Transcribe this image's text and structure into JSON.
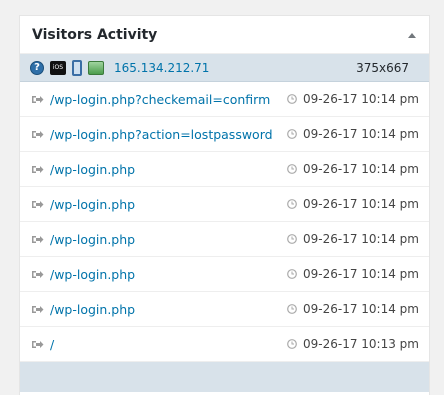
{
  "widget": {
    "title": "Visitors Activity"
  },
  "visitor": {
    "ip": "165.134.212.71",
    "resolution": "375x667",
    "os_label": "iOS"
  },
  "activity": [
    {
      "page": "/wp-login.php?checkemail=confirm",
      "time": "09-26-17 10:14 pm"
    },
    {
      "page": "/wp-login.php?action=lostpassword",
      "time": "09-26-17 10:14 pm"
    },
    {
      "page": "/wp-login.php",
      "time": "09-26-17 10:14 pm"
    },
    {
      "page": "/wp-login.php",
      "time": "09-26-17 10:14 pm"
    },
    {
      "page": "/wp-login.php",
      "time": "09-26-17 10:14 pm"
    },
    {
      "page": "/wp-login.php",
      "time": "09-26-17 10:14 pm"
    },
    {
      "page": "/wp-login.php",
      "time": "09-26-17 10:14 pm"
    },
    {
      "page": "/",
      "time": "09-26-17 10:13 pm"
    }
  ],
  "colors": {
    "link": "#0073aa",
    "visitor_bg": "#d8e2ea"
  }
}
